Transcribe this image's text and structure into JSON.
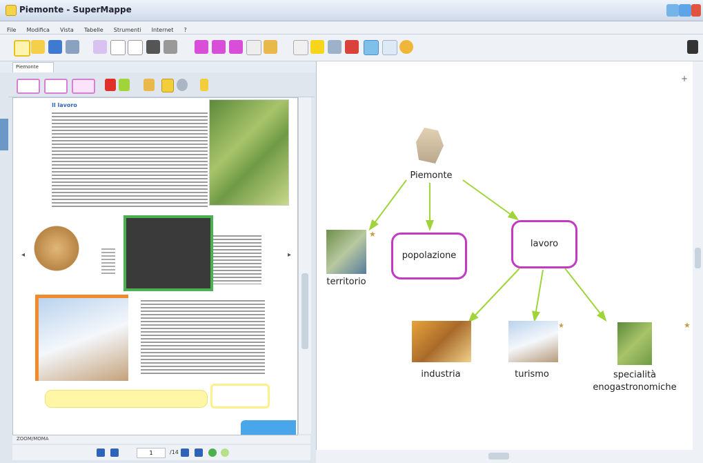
{
  "window": {
    "title": "Piemonte - SuperMappe"
  },
  "menu": {
    "items": [
      "File",
      "Modifica",
      "Vista",
      "Tabelle",
      "Strumenti",
      "Internet",
      "?"
    ]
  },
  "left": {
    "tab_label": "Piemonte",
    "status_label": "ZOOM/MOMA",
    "page": {
      "current": "1",
      "total": "/14"
    },
    "doc_heading": "Il lavoro"
  },
  "map": {
    "root": "Piemonte",
    "nodes": {
      "territorio": "territorio",
      "popolazione": "popolazione",
      "lavoro": "lavoro",
      "industria": "industria",
      "turismo": "turismo",
      "specialita": "specialità enogastronomiche"
    }
  },
  "colors": {
    "node_border": "#c23ac2",
    "arrow": "#9fd43a",
    "accent": "#2f63b8"
  }
}
